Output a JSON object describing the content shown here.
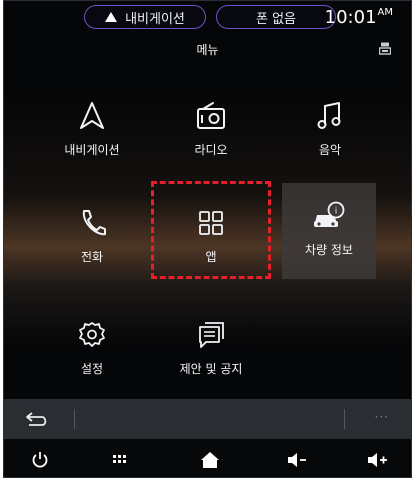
{
  "status_bar": {
    "nav_label": "내비게이션",
    "phone_label": "폰 없음",
    "time": "10:01",
    "ampm": "AM"
  },
  "header": {
    "title": "메뉴"
  },
  "menu": {
    "navigation": "내비게이션",
    "radio": "라디오",
    "music": "음악",
    "phone": "전화",
    "apps": "앱",
    "vehicle_info": "차량 정보",
    "settings": "설정",
    "suggestions": "제안 및 공지"
  },
  "bottom_bar": {
    "more": "···"
  },
  "colors": {
    "accent_pill": "#6f52c4",
    "highlight_box": "#e6202a",
    "background": "#050607"
  },
  "icons": [
    "navigation-arrow-icon",
    "radio-icon",
    "music-note-icon",
    "phone-icon",
    "apps-grid-icon",
    "vehicle-info-icon",
    "settings-gear-icon",
    "suggestions-icon",
    "back-icon",
    "power-icon",
    "grid-dots-icon",
    "home-icon",
    "volume-down-icon",
    "volume-up-icon"
  ]
}
